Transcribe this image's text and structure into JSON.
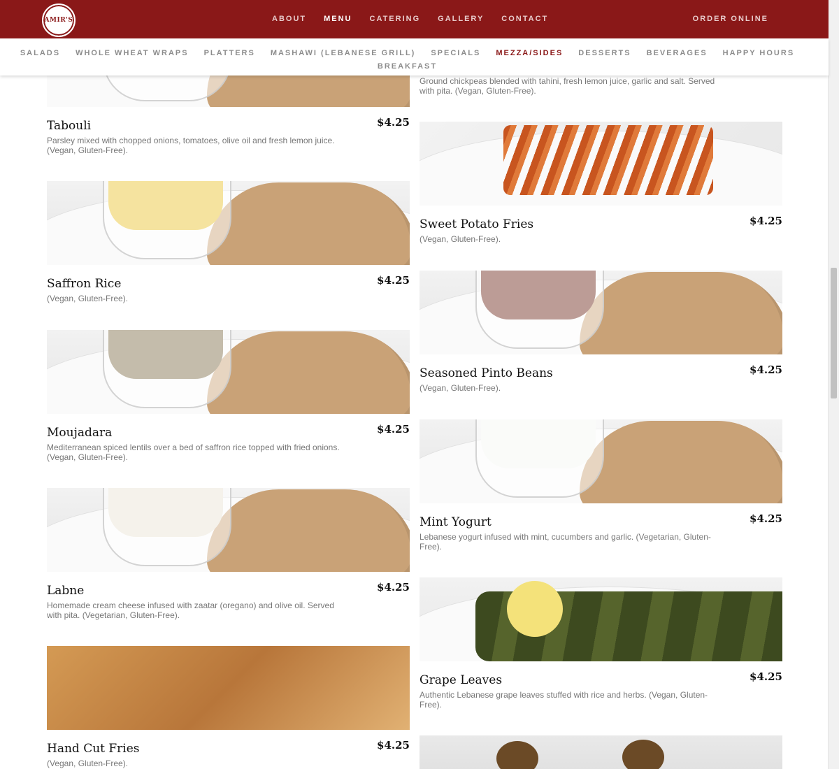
{
  "header": {
    "logo_text": "AMIR'S",
    "nav": [
      "ABOUT",
      "MENU",
      "CATERING",
      "GALLERY",
      "CONTACT"
    ],
    "active_nav": "MENU",
    "order_label": "ORDER ONLINE",
    "brand_color": "#8a1818"
  },
  "subnav": {
    "items": [
      "SALADS",
      "WHOLE WHEAT WRAPS",
      "PLATTERS",
      "MASHAWI (LEBANESE GRILL)",
      "SPECIALS",
      "MEZZA/SIDES",
      "DESSERTS",
      "BEVERAGES",
      "HAPPY HOURS",
      "BREAKFAST"
    ],
    "active": "MEZZA/SIDES"
  },
  "left_column": [
    {
      "name": "Tabouli",
      "price": "$4.25",
      "desc": "Parsley mixed with chopped onions, tomatoes, olive oil and fresh lemon juice. (Vegan, Gluten-Free)."
    },
    {
      "name": "Saffron Rice",
      "price": "$4.25",
      "desc": "(Vegan, Gluten-Free)."
    },
    {
      "name": "Moujadara",
      "price": "$4.25",
      "desc": "Mediterranean spiced lentils over a bed of saffron rice topped with fried onions. (Vegan, Gluten-Free)."
    },
    {
      "name": "Labne",
      "price": "$4.25",
      "desc": "Homemade cream cheese infused with zaatar (oregano) and olive oil. Served with pita. (Vegetarian, Gluten-Free)."
    },
    {
      "name": "Hand Cut Fries",
      "price": "$4.25",
      "desc": "(Vegan, Gluten-Free)."
    }
  ],
  "right_column": [
    {
      "name": "",
      "price": "",
      "desc": "Ground chickpeas blended with tahini, fresh lemon juice, garlic and salt. Served with pita. (Vegan, Gluten-Free)."
    },
    {
      "name": "Sweet Potato Fries",
      "price": "$4.25",
      "desc": "(Vegan, Gluten-Free)."
    },
    {
      "name": "Seasoned Pinto Beans",
      "price": "$4.25",
      "desc": "(Vegan, Gluten-Free)."
    },
    {
      "name": "Mint Yogurt",
      "price": "$4.25",
      "desc": "Lebanese yogurt infused with mint, cucumbers and garlic. (Vegetarian, Gluten-Free)."
    },
    {
      "name": "Grape Leaves",
      "price": "$4.25",
      "desc": "Authentic Lebanese grape leaves stuffed with rice and herbs. (Vegan, Gluten-Free)."
    }
  ],
  "icons": {
    "logo": "restaurant-logo-icon"
  }
}
